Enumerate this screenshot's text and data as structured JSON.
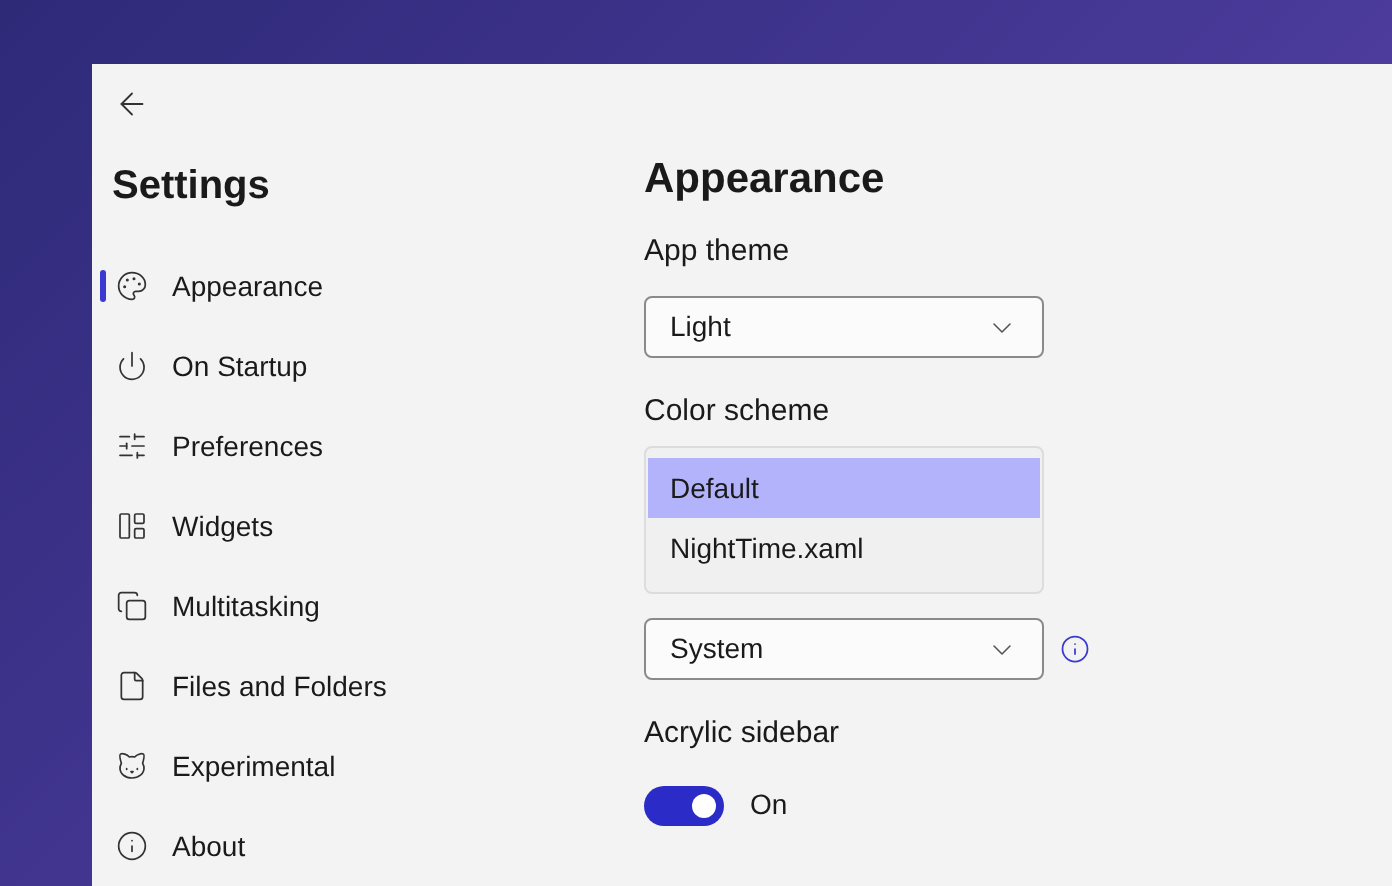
{
  "window": {
    "title": "Settings"
  },
  "sidebar": {
    "items": [
      {
        "label": "Appearance",
        "selected": true
      },
      {
        "label": "On Startup",
        "selected": false
      },
      {
        "label": "Preferences",
        "selected": false
      },
      {
        "label": "Widgets",
        "selected": false
      },
      {
        "label": "Multitasking",
        "selected": false
      },
      {
        "label": "Files and Folders",
        "selected": false
      },
      {
        "label": "Experimental",
        "selected": false
      },
      {
        "label": "About",
        "selected": false
      }
    ]
  },
  "page": {
    "title": "Appearance",
    "app_theme": {
      "label": "App theme",
      "value": "Light"
    },
    "color_scheme": {
      "label": "Color scheme",
      "options": [
        {
          "label": "Default",
          "selected": true
        },
        {
          "label": "NightTime.xaml",
          "selected": false
        }
      ]
    },
    "system_dropdown": {
      "value": "System"
    },
    "acrylic_sidebar": {
      "label": "Acrylic sidebar",
      "on": true,
      "state_text": "On"
    }
  }
}
